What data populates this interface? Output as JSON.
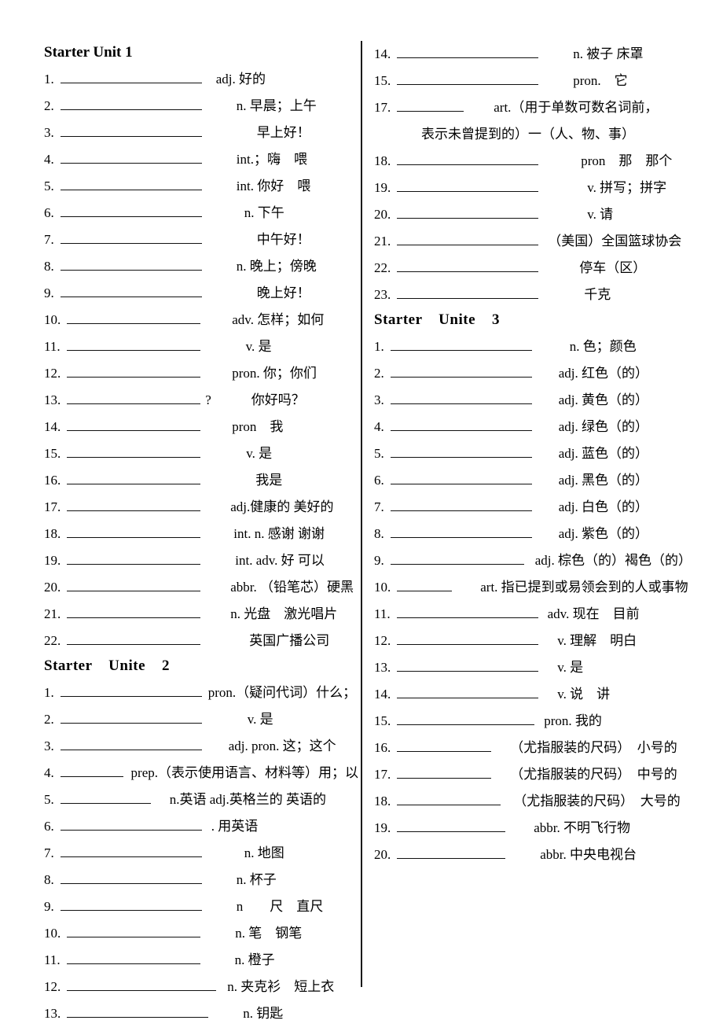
{
  "document": {
    "type": "vocabulary-worksheet",
    "language": "zh-CN"
  },
  "columns": {
    "left": {
      "sections": [
        {
          "heading": "Starter Unit 1",
          "heading_style": "plain",
          "entries": [
            {
              "num": "1.",
              "blank_width": 180,
              "gap": 16,
              "definition": "adj.  好的"
            },
            {
              "num": "2.",
              "blank_width": 180,
              "gap": 42,
              "definition": "n. 早晨；上午"
            },
            {
              "num": "3.",
              "blank_width": 180,
              "gap": 68,
              "definition": "早上好！"
            },
            {
              "num": "4.",
              "blank_width": 180,
              "gap": 42,
              "definition": "int.；嗨　喂"
            },
            {
              "num": "5.",
              "blank_width": 180,
              "gap": 42,
              "definition": "int.  你好　喂"
            },
            {
              "num": "6.",
              "blank_width": 180,
              "gap": 52,
              "definition": "n.  下午"
            },
            {
              "num": "7.",
              "blank_width": 180,
              "gap": 68,
              "definition": "中午好！"
            },
            {
              "num": "8.",
              "blank_width": 180,
              "gap": 42,
              "definition": "n.  晚上；傍晚"
            },
            {
              "num": "9.",
              "blank_width": 180,
              "gap": 68,
              "definition": "晚上好！"
            },
            {
              "num": "10.",
              "blank_width": 170,
              "gap": 38,
              "definition": "adv.  怎样；如何"
            },
            {
              "num": "11.",
              "blank_width": 170,
              "gap": 56,
              "definition": "v.   是"
            },
            {
              "num": "12.",
              "blank_width": 170,
              "gap": 38,
              "definition": "pron.  你；你们"
            },
            {
              "num": "13.",
              "blank_width": 170,
              "gap": 4,
              "definition": "?　　　你好吗？"
            },
            {
              "num": "14.",
              "blank_width": 170,
              "gap": 38,
              "definition": "pron　我"
            },
            {
              "num": "15.",
              "blank_width": 170,
              "gap": 56,
              "definition": "v.   是"
            },
            {
              "num": "16.",
              "blank_width": 170,
              "gap": 68,
              "definition": "我是"
            },
            {
              "num": "17.",
              "blank_width": 170,
              "gap": 36,
              "definition": "adj.健康的  美好的"
            },
            {
              "num": "18.",
              "blank_width": 170,
              "gap": 40,
              "definition": "int. n.    感谢  谢谢"
            },
            {
              "num": "19.",
              "blank_width": 170,
              "gap": 42,
              "definition": "int. adv. 好  可以"
            },
            {
              "num": "20.",
              "blank_width": 170,
              "gap": 36,
              "definition": "abbr. （铅笔芯）硬黑"
            },
            {
              "num": "21.",
              "blank_width": 170,
              "gap": 36,
              "definition": "n.  光盘　激光唱片"
            },
            {
              "num": "22.",
              "blank_width": 170,
              "gap": 60,
              "definition": "英国广播公司"
            }
          ]
        },
        {
          "heading": "Starter    Unite    2",
          "heading_style": "spaced",
          "entries": [
            {
              "num": "1.",
              "blank_width": 180,
              "gap": 6,
              "definition": "pron.（疑问代词）什么；"
            },
            {
              "num": "2.",
              "blank_width": 180,
              "gap": 56,
              "definition": "v.   是"
            },
            {
              "num": "3.",
              "blank_width": 180,
              "gap": 32,
              "definition": "adj. pron.  这；这个"
            },
            {
              "num": "4.",
              "blank_width": 80,
              "gap": 16,
              "definition": "prep.（表示使用语言、材料等）用；以"
            },
            {
              "num": "5.",
              "blank_width": 115,
              "gap": 22,
              "definition": "n.英语  adj.英格兰的  英语的"
            },
            {
              "num": "6.",
              "blank_width": 180,
              "gap": 10,
              "definition": ".  用英语"
            },
            {
              "num": "7.",
              "blank_width": 180,
              "gap": 52,
              "definition": "n. 地图"
            },
            {
              "num": "8.",
              "blank_width": 180,
              "gap": 42,
              "definition": "n.    杯子"
            },
            {
              "num": "9.",
              "blank_width": 180,
              "gap": 42,
              "definition": "n　　尺　直尺"
            },
            {
              "num": "10.",
              "blank_width": 170,
              "gap": 42,
              "definition": "n.    笔　钢笔"
            },
            {
              "num": "11.",
              "blank_width": 170,
              "gap": 42,
              "definition": "n.    橙子"
            },
            {
              "num": "12.",
              "blank_width": 190,
              "gap": 12,
              "definition": "n. 夹克衫　短上衣"
            },
            {
              "num": "13.",
              "blank_width": 180,
              "gap": 42,
              "definition": "n.    钥匙"
            }
          ]
        }
      ]
    },
    "right": {
      "sections": [
        {
          "heading": null,
          "heading_style": null,
          "entries": [
            {
              "num": "14.",
              "blank_width": 180,
              "gap": 42,
              "definition": "n.    被子  床罩"
            },
            {
              "num": "15.",
              "blank_width": 180,
              "gap": 42,
              "definition": "pron.　它"
            },
            {
              "num": "17.",
              "blank_width": 85,
              "gap": 36,
              "definition": "art.（用于单数可数名词前，",
              "continuation": "表示未曾提到的）一（人、物、事）",
              "continuation_indent": 60
            },
            {
              "num": "18.",
              "blank_width": 180,
              "gap": 52,
              "definition": "pron　那　那个"
            },
            {
              "num": "19.",
              "blank_width": 180,
              "gap": 60,
              "definition": "v. 拼写；拼字"
            },
            {
              "num": "20.",
              "blank_width": 180,
              "gap": 60,
              "definition": "v. 请"
            },
            {
              "num": "21.",
              "blank_width": 180,
              "gap": 10,
              "definition": "（美国）全国篮球协会"
            },
            {
              "num": "22.",
              "blank_width": 180,
              "gap": 50,
              "definition": "停车（区）"
            },
            {
              "num": "23.",
              "blank_width": 180,
              "gap": 56,
              "definition": "千克"
            }
          ]
        },
        {
          "heading": "Starter    Unite    3",
          "heading_style": "spaced",
          "entries": [
            {
              "num": "1.",
              "blank_width": 180,
              "gap": 46,
              "definition": "n. 色；颜色"
            },
            {
              "num": "2.",
              "blank_width": 180,
              "gap": 32,
              "definition": "adj.  红色（的）"
            },
            {
              "num": "3.",
              "blank_width": 180,
              "gap": 32,
              "definition": "adj.   黄色（的）"
            },
            {
              "num": "4.",
              "blank_width": 180,
              "gap": 32,
              "definition": "adj. 绿色（的）"
            },
            {
              "num": "5.",
              "blank_width": 180,
              "gap": 32,
              "definition": "adj.  蓝色（的）"
            },
            {
              "num": "6.",
              "blank_width": 180,
              "gap": 32,
              "definition": "adj.  黑色（的）"
            },
            {
              "num": "7.",
              "blank_width": 180,
              "gap": 32,
              "definition": "adj.  白色（的）"
            },
            {
              "num": "8.",
              "blank_width": 180,
              "gap": 32,
              "definition": "adj.  紫色（的）"
            },
            {
              "num": "9.",
              "blank_width": 170,
              "gap": 12,
              "definition": "adj. 棕色（的）褐色（的）"
            },
            {
              "num": "10.",
              "blank_width": 70,
              "gap": 34,
              "definition": "art. 指已提到或易领会到的人或事物"
            },
            {
              "num": "11.",
              "blank_width": 180,
              "gap": 10,
              "definition": "adv. 现在　目前"
            },
            {
              "num": "12.",
              "blank_width": 180,
              "gap": 22,
              "definition": "v. 理解　明白"
            },
            {
              "num": "13.",
              "blank_width": 180,
              "gap": 22,
              "definition": "v. 是"
            },
            {
              "num": "14.",
              "blank_width": 180,
              "gap": 22,
              "definition": "v. 说　讲"
            },
            {
              "num": "15.",
              "blank_width": 175,
              "gap": 10,
              "definition": "pron. 我的"
            },
            {
              "num": "16.",
              "blank_width": 120,
              "gap": 22,
              "definition": "（尤指服装的尺码）　小号的"
            },
            {
              "num": "17.",
              "blank_width": 120,
              "gap": 22,
              "definition": "（尤指服装的尺码）　中号的"
            },
            {
              "num": "18.",
              "blank_width": 132,
              "gap": 14,
              "definition": "（尤指服装的尺码）　大号的"
            },
            {
              "num": "19.",
              "blank_width": 138,
              "gap": 34,
              "definition": "abbr.   不明飞行物"
            },
            {
              "num": "20.",
              "blank_width": 138,
              "gap": 42,
              "definition": "abbr.   中央电视台"
            }
          ]
        }
      ]
    }
  }
}
